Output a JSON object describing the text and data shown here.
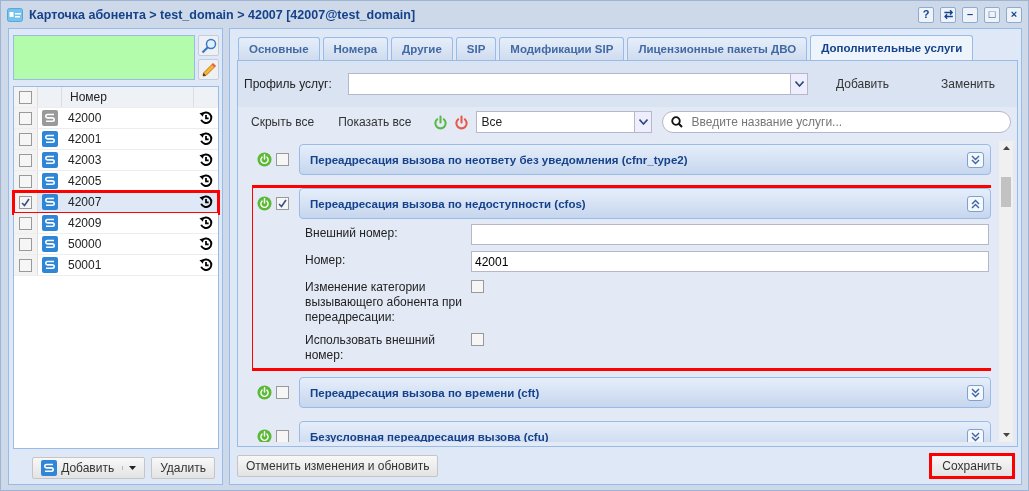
{
  "window": {
    "title": "Карточка абонента > test_domain > 42007 [42007@test_domain]",
    "controls": [
      "?",
      "⇄",
      "–",
      "□",
      "×"
    ]
  },
  "left": {
    "header_checked": false,
    "column": "Номер",
    "rows": [
      {
        "number": "42000",
        "checked": false,
        "active": false,
        "highlighted": false,
        "selected": false
      },
      {
        "number": "42001",
        "checked": false,
        "active": true,
        "highlighted": false,
        "selected": false
      },
      {
        "number": "42003",
        "checked": false,
        "active": true,
        "highlighted": false,
        "selected": false
      },
      {
        "number": "42005",
        "checked": false,
        "active": true,
        "highlighted": false,
        "selected": false
      },
      {
        "number": "42007",
        "checked": true,
        "active": true,
        "highlighted": true,
        "selected": true
      },
      {
        "number": "42009",
        "checked": false,
        "active": true,
        "highlighted": false,
        "selected": false
      },
      {
        "number": "50000",
        "checked": false,
        "active": true,
        "highlighted": false,
        "selected": false
      },
      {
        "number": "50001",
        "checked": false,
        "active": true,
        "highlighted": false,
        "selected": false
      }
    ],
    "add_button": "Добавить",
    "delete_button": "Удалить"
  },
  "tabs": [
    {
      "label": "Основные",
      "selected": false
    },
    {
      "label": "Номера",
      "selected": false
    },
    {
      "label": "Другие",
      "selected": false
    },
    {
      "label": "SIP",
      "selected": false
    },
    {
      "label": "Модификации SIP",
      "selected": false
    },
    {
      "label": "Лицензионные пакеты ДВО",
      "selected": false
    },
    {
      "label": "Дополнительные услуги",
      "selected": true
    }
  ],
  "profile": {
    "label": "Профиль услуг:",
    "add": "Добавить",
    "replace": "Заменить"
  },
  "toolbar": {
    "hide_all": "Скрыть все",
    "show_all": "Показать все",
    "filter": "Все",
    "search_placeholder": "Введите название услуги..."
  },
  "services": [
    {
      "title": "Переадресация вызова по неответу без уведомления (cfnr_type2)",
      "checked": false,
      "expanded": false,
      "highlighted": false
    },
    {
      "title": "Переадресация вызова по недоступности (cfos)",
      "checked": true,
      "expanded": true,
      "highlighted": true,
      "fields": [
        {
          "kind": "text",
          "label": "Внешний номер:"
        },
        {
          "kind": "text",
          "label": "Номер:",
          "value": "42001"
        },
        {
          "kind": "checkbox",
          "label": "Изменение категории вызывающего абонента при переадресации:",
          "checked": false
        },
        {
          "kind": "checkbox",
          "label": "Использовать внешний номер:",
          "checked": false
        }
      ]
    },
    {
      "title": "Переадресация вызова по времени (cft)",
      "checked": false,
      "expanded": false,
      "highlighted": false
    },
    {
      "title": "Безусловная переадресация вызова (cfu)",
      "checked": false,
      "expanded": false,
      "highlighted": false
    }
  ],
  "footer": {
    "revert": "Отменить изменения и обновить",
    "save": "Сохранить",
    "save_highlighted": true
  }
}
